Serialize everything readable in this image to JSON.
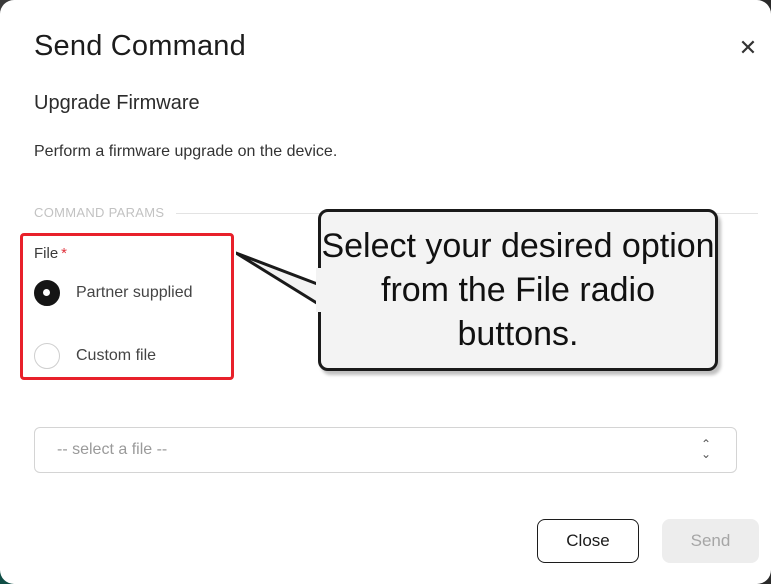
{
  "dialog": {
    "title": "Send Command",
    "close_icon": "close-icon"
  },
  "command": {
    "name": "Upgrade Firmware",
    "description": "Perform a firmware upgrade on the device."
  },
  "params": {
    "section_label": "COMMAND PARAMS",
    "file_label": "File",
    "required_marker": "*",
    "options": [
      {
        "label": "Partner supplied",
        "checked": true
      },
      {
        "label": "Custom file",
        "checked": false
      }
    ]
  },
  "file_select": {
    "value": "-- select a file --",
    "chevron_icon": "up-down-chevron-icon"
  },
  "footer": {
    "close_label": "Close",
    "send_label": "Send"
  },
  "annotation": {
    "callout_text": "Select your desired option from the File radio buttons.",
    "highlight_color": "#e8202a"
  }
}
